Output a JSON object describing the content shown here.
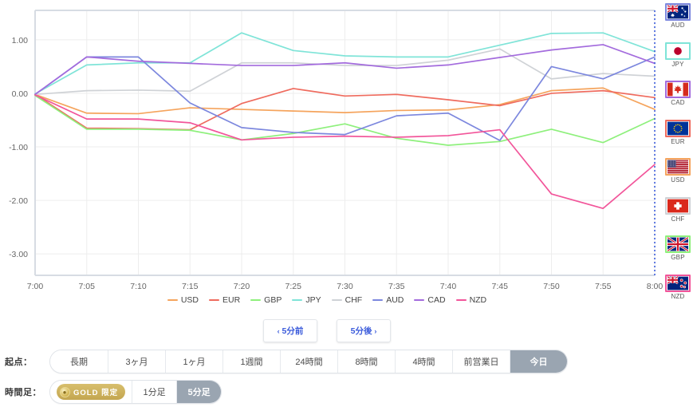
{
  "chart_data": {
    "type": "line",
    "title": "",
    "xlabel": "",
    "ylabel": "",
    "x": [
      "7:00",
      "7:05",
      "7:10",
      "7:15",
      "7:20",
      "7:25",
      "7:30",
      "7:35",
      "7:40",
      "7:45",
      "7:50",
      "7:55",
      "8:00"
    ],
    "categories": [
      "7:00",
      "7:05",
      "7:10",
      "7:15",
      "7:20",
      "7:25",
      "7:30",
      "7:35",
      "7:40",
      "7:45",
      "7:50",
      "7:55",
      "8:00"
    ],
    "ylim": [
      -3.4,
      1.55
    ],
    "yticks": [
      1.0,
      0.0,
      -1.0,
      -2.0,
      -3.0
    ],
    "ytick_labels": [
      "1.00",
      "0.00",
      "-1.00",
      "-2.00",
      "-3.00"
    ],
    "grid": true,
    "legend_position": "bottom",
    "series": [
      {
        "name": "USD",
        "color": "#f5a45d",
        "values": [
          -0.02,
          -0.37,
          -0.38,
          -0.27,
          -0.3,
          -0.33,
          -0.36,
          -0.32,
          -0.31,
          -0.21,
          0.05,
          0.1,
          -0.3
        ]
      },
      {
        "name": "EUR",
        "color": "#ef6b5e",
        "values": [
          -0.02,
          -0.65,
          -0.66,
          -0.68,
          -0.19,
          0.09,
          -0.05,
          -0.02,
          -0.12,
          -0.23,
          0.0,
          0.05,
          -0.08
        ]
      },
      {
        "name": "GBP",
        "color": "#8ef07c",
        "values": [
          -0.04,
          -0.67,
          -0.67,
          -0.69,
          -0.87,
          -0.75,
          -0.57,
          -0.84,
          -0.97,
          -0.9,
          -0.67,
          -0.92,
          -0.47
        ]
      },
      {
        "name": "JPY",
        "color": "#7fe4d8",
        "values": [
          -0.01,
          0.53,
          0.57,
          0.57,
          1.13,
          0.8,
          0.7,
          0.68,
          0.68,
          0.9,
          1.12,
          1.13,
          0.78
        ]
      },
      {
        "name": "CHF",
        "color": "#cfd2d6",
        "values": [
          -0.02,
          0.05,
          0.06,
          0.04,
          0.57,
          0.57,
          0.52,
          0.52,
          0.62,
          0.83,
          0.27,
          0.37,
          0.32
        ]
      },
      {
        "name": "AUD",
        "color": "#7c87de",
        "values": [
          -0.02,
          0.68,
          0.68,
          -0.18,
          -0.64,
          -0.73,
          -0.77,
          -0.42,
          -0.37,
          -0.88,
          0.5,
          0.27,
          0.68
        ]
      },
      {
        "name": "CAD",
        "color": "#a36bdd",
        "values": [
          -0.02,
          0.68,
          0.6,
          0.56,
          0.52,
          0.52,
          0.57,
          0.47,
          0.53,
          0.67,
          0.81,
          0.91,
          0.56
        ]
      },
      {
        "name": "NZD",
        "color": "#f2559a",
        "values": [
          -0.03,
          -0.48,
          -0.48,
          -0.55,
          -0.87,
          -0.82,
          -0.8,
          -0.82,
          -0.79,
          -0.68,
          -1.88,
          -2.15,
          -1.33
        ]
      }
    ]
  },
  "flags": [
    {
      "code": "AUD",
      "border": "#7c87de"
    },
    {
      "code": "JPY",
      "border": "#7fe4d8"
    },
    {
      "code": "CAD",
      "border": "#a36bdd"
    },
    {
      "code": "EUR",
      "border": "#ef6b5e"
    },
    {
      "code": "USD",
      "border": "#f5a45d"
    },
    {
      "code": "CHF",
      "border": "#cfd2d6"
    },
    {
      "code": "GBP",
      "border": "#8ef07c"
    },
    {
      "code": "NZD",
      "border": "#f2559a"
    }
  ],
  "nav": {
    "prev_label": "5分前",
    "next_label": "5分後",
    "prev_chevron": "‹",
    "next_chevron": "›"
  },
  "controls": {
    "origin": {
      "label": "起点：",
      "options": [
        "長期",
        "3ヶ月",
        "1ヶ月",
        "1週間",
        "24時間",
        "8時間",
        "4時間",
        "前営業日",
        "今日"
      ],
      "selected": "今日"
    },
    "timeframe": {
      "label": "時間足：",
      "gold_badge": "GOLD 限定",
      "options": [
        "1分足",
        "5分足"
      ],
      "selected": "5分足"
    }
  },
  "colors": {
    "accent_blue": "#3b5bdb",
    "active_pill": "#9aa5b1",
    "grid": "#ededed",
    "axis": "#d7dce3"
  }
}
